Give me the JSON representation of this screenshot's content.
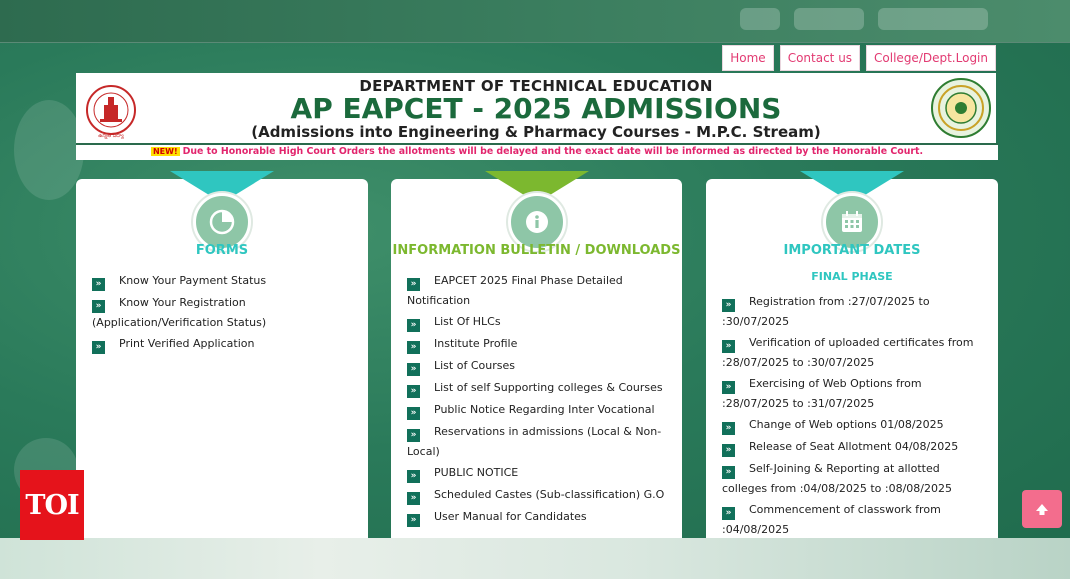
{
  "nav": {
    "home": "Home",
    "contact": "Contact us",
    "login": "College/Dept.Login"
  },
  "header": {
    "department": "DEPARTMENT OF TECHNICAL EDUCATION",
    "title": "AP EAPCET - 2025 ADMISSIONS",
    "subtitle": "(Admissions into Engineering & Pharmacy Courses - M.P.C. Stream)"
  },
  "ticker": {
    "badge": "NEW!",
    "text": "Due to Honorable High Court Orders the allotments will be delayed and the exact date will be informed as directed by the Honorable Court."
  },
  "forms": {
    "heading": "FORMS",
    "items": [
      "Know Your Payment Status",
      "Know Your Registration (Application/Verification Status)",
      "Print Verified Application"
    ]
  },
  "bulletin": {
    "heading": "INFORMATION BULLETIN / DOWNLOADS",
    "items": [
      "EAPCET 2025 Final Phase Detailed Notification",
      "List Of HLCs",
      "Institute Profile",
      "List of Courses",
      "List of self Supporting colleges & Courses",
      "Public Notice Regarding Inter Vocational",
      "Reservations in admissions (Local & Non-Local)",
      "PUBLIC NOTICE",
      "Scheduled Castes (Sub-classification) G.O",
      "User Manual for Candidates"
    ]
  },
  "dates": {
    "heading": "IMPORTANT DATES",
    "phase": "FINAL PHASE",
    "items": [
      "Registration from :27/07/2025 to :30/07/2025",
      "Verification of uploaded certificates from :28/07/2025 to :30/07/2025",
      "Exercising of Web Options from :28/07/2025 to :31/07/2025",
      "Change of Web options 01/08/2025",
      "Release of Seat Allotment 04/08/2025",
      "Self-Joining & Reporting at allotted colleges from :04/08/2025 to :08/08/2025",
      "Commencement of classwork from :04/08/2025"
    ]
  },
  "watermark": "TOI",
  "colors": {
    "accent_pink": "#e23a72",
    "title_green": "#1b6a3c",
    "teal": "#2fc6c0",
    "lime": "#7cb82f",
    "chevron": "#11705a"
  }
}
